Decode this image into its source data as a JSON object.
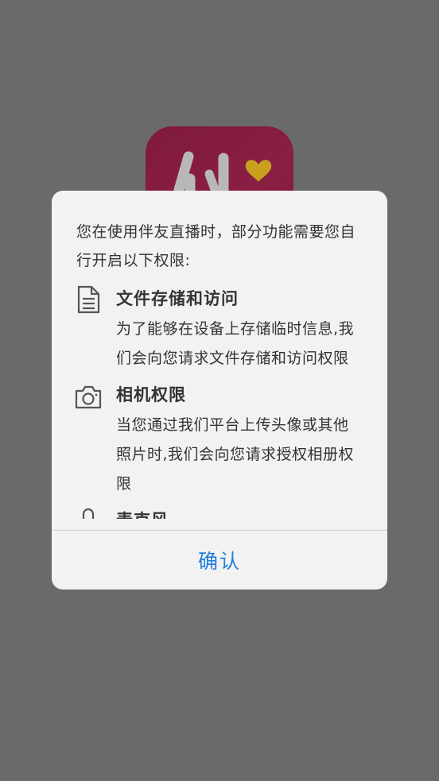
{
  "colors": {
    "overlay_background": "#6a6a6a",
    "dialog_background": "#f2f2f2",
    "text": "#333333",
    "accent": "#1e7ee0",
    "logo_primary": "#8a1f44",
    "logo_heart": "#c8a01e"
  },
  "dialog": {
    "intro": "您在使用伴友直播时，部分功能需要您自行开启以下权限:",
    "permissions": [
      {
        "icon": "document-icon",
        "title": "文件存储和访问",
        "description": "为了能够在设备上存储临时信息,我们会向您请求文件存储和访问权限"
      },
      {
        "icon": "camera-icon",
        "title": "相机权限",
        "description": "当您通过我们平台上传头像或其他照片时,我们会向您请求授权相册权限"
      },
      {
        "icon": "microphone-icon",
        "title": "麦克风",
        "description": ""
      }
    ],
    "confirm_label": "确认"
  }
}
